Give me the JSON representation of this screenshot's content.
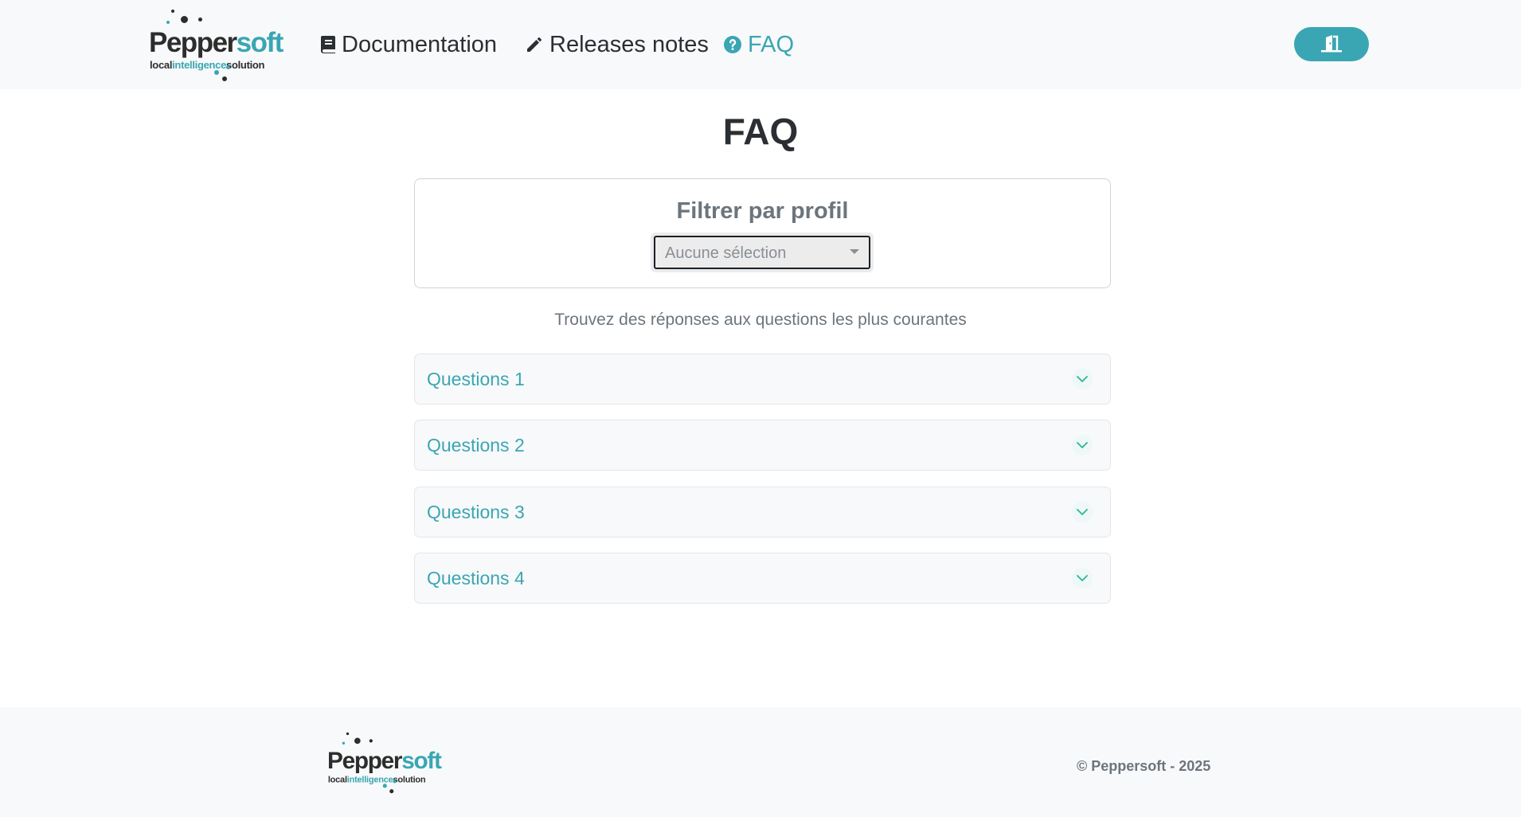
{
  "logo": {
    "brand_dark": "Pepper",
    "brand_accent": "soft",
    "tag_left": "local",
    "tag_mid": "intelligence",
    "tag_right": "solution"
  },
  "nav": {
    "items": [
      {
        "label": "Documentation",
        "icon": "book-icon",
        "active": false
      },
      {
        "label": "Releases notes",
        "icon": "pencil-icon",
        "active": false
      },
      {
        "label": "FAQ",
        "icon": "question-circle-icon",
        "active": true
      }
    ]
  },
  "header": {
    "logout_icon": "door-exit-icon"
  },
  "main": {
    "title": "FAQ",
    "filter": {
      "title": "Filtrer par profil",
      "selected": "Aucune sélection"
    },
    "subtitle": "Trouvez des réponses aux questions les plus courantes",
    "accordion": [
      {
        "label": "Questions 1",
        "expanded": false
      },
      {
        "label": "Questions 2",
        "expanded": false
      },
      {
        "label": "Questions 3",
        "expanded": false
      },
      {
        "label": "Questions 4",
        "expanded": false
      }
    ]
  },
  "footer": {
    "copyright": "© Peppersoft - 2025"
  },
  "colors": {
    "accent": "#3aa6b3",
    "text_dark": "#2b2f33",
    "text_muted": "#6c757d",
    "header_bg": "#f8f9fa"
  }
}
